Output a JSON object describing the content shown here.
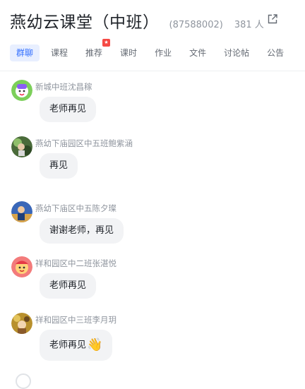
{
  "header": {
    "title": "燕幼云课堂（中班）",
    "group_id": "(87588002)",
    "member_count": "381 人",
    "open_icon": "external-link-icon"
  },
  "tabs": [
    {
      "label": "群聊",
      "active": true
    },
    {
      "label": "课程"
    },
    {
      "label": "推荐",
      "badge": true
    },
    {
      "label": "课时"
    },
    {
      "label": "作业"
    },
    {
      "label": "文件"
    },
    {
      "label": "讨论帖"
    },
    {
      "label": "公告"
    }
  ],
  "messages": [
    {
      "sender": "新城中班沈昌稼",
      "text": "老师再见"
    },
    {
      "sender": "燕幼下庙园区中五班鲍紫涵",
      "text": "再见"
    },
    {
      "sender": "燕幼下庙区中五陈夕璨",
      "text": "谢谢老师，再见"
    },
    {
      "sender": "祥和园区中二班张湛悦",
      "text": "老师再见"
    },
    {
      "sender": "祥和园区中三班李月玥",
      "text": "老师再见",
      "emoji": "👋"
    }
  ],
  "colors": {
    "accent": "#3370ff",
    "badge": "#f54a45",
    "bubble": "#f2f3f5",
    "muted": "#8f959e"
  }
}
